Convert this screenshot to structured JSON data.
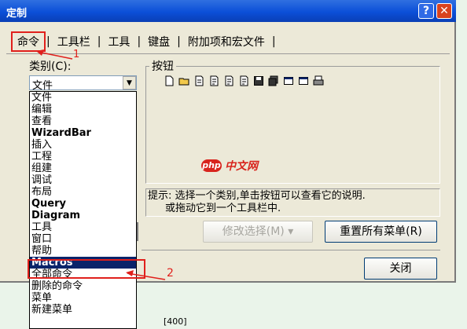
{
  "window": {
    "title": "定制",
    "help_label": "?",
    "close_label": "✕"
  },
  "tabs": [
    {
      "label": "命令"
    },
    {
      "label": "工具栏"
    },
    {
      "label": "工具"
    },
    {
      "label": "键盘"
    },
    {
      "label": "附加项和宏文件"
    }
  ],
  "tab_separator": "|",
  "category": {
    "label": "类别(C):",
    "selected_value": "文件",
    "items": [
      "文件",
      "编辑",
      "查看",
      "WizardBar",
      "插入",
      "工程",
      "组建",
      "调试",
      "布局",
      "Query",
      "Diagram",
      "工具",
      "窗口",
      "帮助",
      "Macros",
      "全部命令",
      "删除的命令",
      "菜单",
      "新建菜单"
    ]
  },
  "buttons_group": {
    "label": "按钮",
    "icons": [
      "new-file-icon",
      "open-folder-icon",
      "close-doc-icon",
      "doc-icon",
      "doc-icon",
      "doc-icon",
      "save-icon",
      "save-all-icon",
      "window-icon",
      "window-icon",
      "print-icon"
    ]
  },
  "hint": {
    "line1": "提示: 选择一个类别,单击按钮可以查看它的说明.",
    "line2": "或拖动它到一个工具栏中."
  },
  "actions": {
    "modify_selection": "修改选择(M) ▾",
    "reset_menus": "重置所有菜单(R)",
    "close": "关闭"
  },
  "watermark": {
    "badge": "php",
    "text": "中文网"
  },
  "annotations": {
    "num1": "1",
    "num2": "2",
    "color": "#e0201c"
  },
  "bottom_fragment": "[400]"
}
